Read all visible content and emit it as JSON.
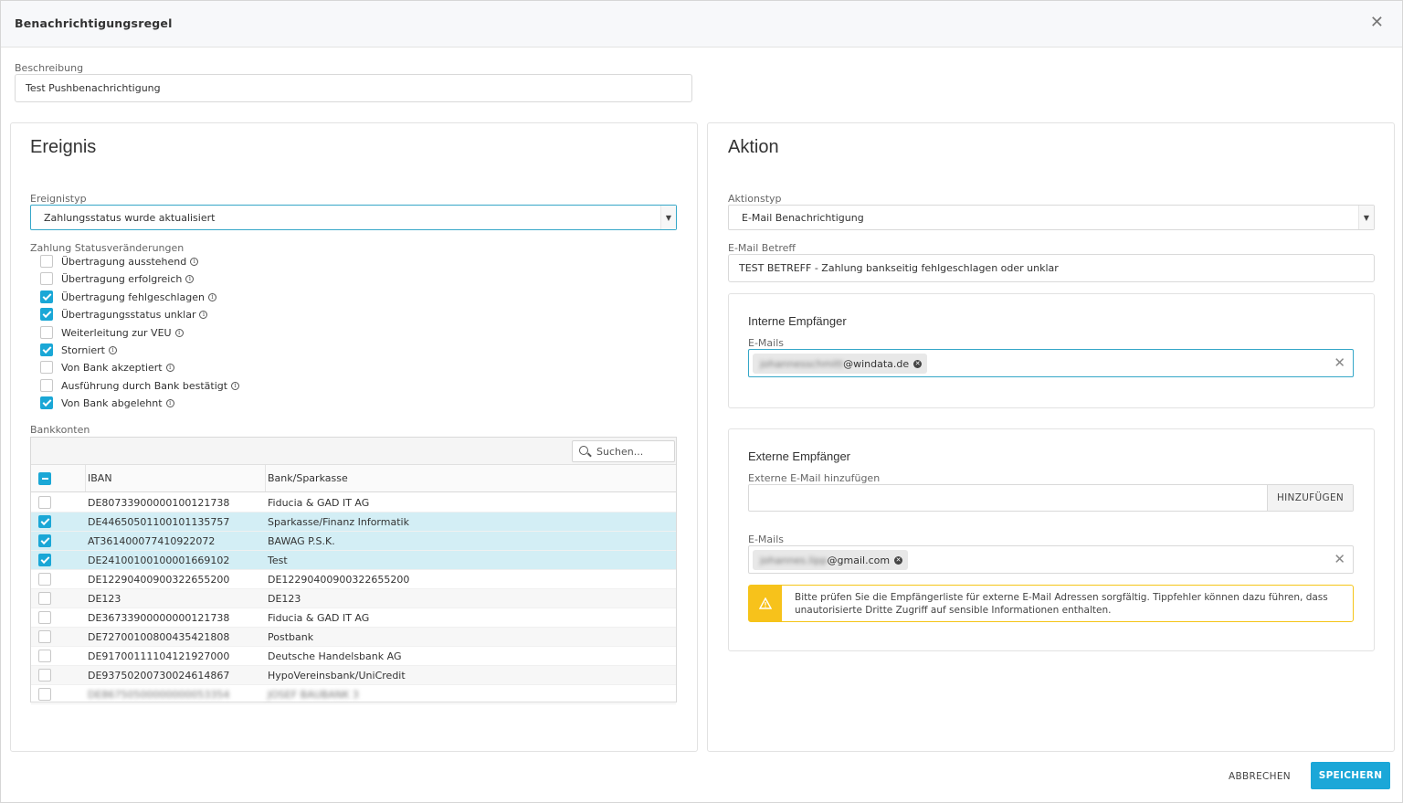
{
  "dialog": {
    "title": "Benachrichtigungsregel",
    "close_icon": "close-icon"
  },
  "description": {
    "label": "Beschreibung",
    "value": "Test Pushbenachrichtigung"
  },
  "event": {
    "title": "Ereignis",
    "type_label": "Ereignistyp",
    "type_value": "Zahlungsstatus wurde aktualisiert",
    "status_label": "Zahlung Statusveränderungen",
    "statuses": [
      {
        "label": "Übertragung ausstehend",
        "checked": false
      },
      {
        "label": "Übertragung erfolgreich",
        "checked": false
      },
      {
        "label": "Übertragung fehlgeschlagen",
        "checked": true
      },
      {
        "label": "Übertragungsstatus unklar",
        "checked": true
      },
      {
        "label": "Weiterleitung zur VEU",
        "checked": false
      },
      {
        "label": "Storniert",
        "checked": true
      },
      {
        "label": "Von Bank akzeptiert",
        "checked": false
      },
      {
        "label": "Ausführung durch Bank bestätigt",
        "checked": false
      },
      {
        "label": "Von Bank abgelehnt",
        "checked": true
      }
    ],
    "accounts_label": "Bankkonten",
    "search_placeholder": "Suchen...",
    "columns": {
      "iban": "IBAN",
      "bank": "Bank/Sparkasse"
    },
    "accounts": [
      {
        "iban": "DE80733900000100121738",
        "bank": "Fiducia & GAD IT AG",
        "checked": false
      },
      {
        "iban": "DE44650501100101135757",
        "bank": "Sparkasse/Finanz Informatik",
        "checked": true
      },
      {
        "iban": "AT361400077410922072",
        "bank": "BAWAG P.S.K.",
        "checked": true
      },
      {
        "iban": "DE24100100100001669102",
        "bank": "Test",
        "checked": true
      },
      {
        "iban": "DE12290400900322655200",
        "bank": "DE12290400900322655200",
        "checked": false
      },
      {
        "iban": "DE123",
        "bank": "DE123",
        "checked": false
      },
      {
        "iban": "DE36733900000000121738",
        "bank": "Fiducia & GAD IT AG",
        "checked": false
      },
      {
        "iban": "DE72700100800435421808",
        "bank": "Postbank",
        "checked": false
      },
      {
        "iban": "DE91700111104121927000",
        "bank": "Deutsche Handelsbank AG",
        "checked": false
      },
      {
        "iban": "DE93750200730024614867",
        "bank": "HypoVereinsbank/UniCredit",
        "checked": false
      },
      {
        "iban": "DE86750500000000053354",
        "bank": "JOSEF BAUBANK 3",
        "checked": false,
        "blurred": true
      }
    ]
  },
  "action": {
    "title": "Aktion",
    "type_label": "Aktionstyp",
    "type_value": "E-Mail Benachrichtigung",
    "subject_label": "E-Mail Betreff",
    "subject_value": "TEST BETREFF - Zahlung bankseitig fehlgeschlagen oder unklar",
    "internal": {
      "title": "Interne Empfänger",
      "emails_label": "E-Mails",
      "chip_hidden": "johannesschmitt",
      "chip_domain": "@windata.de"
    },
    "external": {
      "title": "Externe Empfänger",
      "add_label": "Externe E-Mail hinzufügen",
      "add_value": "",
      "add_button": "HINZUFÜGEN",
      "emails_label": "E-Mails",
      "chip_hidden": "johannes.lipp",
      "chip_domain": "@gmail.com",
      "warning_line1": "Bitte prüfen Sie die Empfängerliste für externe E-Mail Adressen sorgfältig. Tippfehler können dazu führen, dass",
      "warning_line2": "unautorisierte Dritte Zugriff auf sensible Informationen enthalten."
    }
  },
  "footer": {
    "cancel": "ABBRECHEN",
    "save": "SPEICHERN"
  },
  "colors": {
    "accent": "#1ba7d8",
    "selected_row": "#d3eef5",
    "warning": "#f7c21b"
  }
}
